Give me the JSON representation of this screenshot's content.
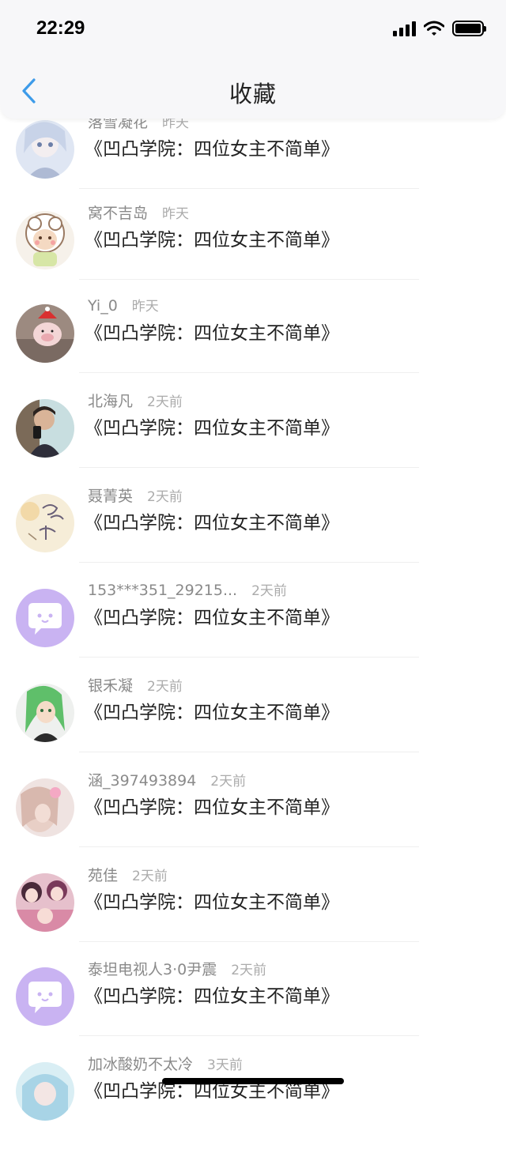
{
  "status_bar": {
    "time": "22:29"
  },
  "header": {
    "title": "收藏",
    "back_icon": "chevron-left-icon",
    "accent_color": "#3d9be9"
  },
  "favorites": [
    {
      "user": "落雪凝花",
      "time": "昨天",
      "title": "《凹凸学院：四位女主不简单》",
      "avatar": "anime-girl-avatar"
    },
    {
      "user": "窝不吉岛",
      "time": "昨天",
      "title": "《凹凸学院：四位女主不简单》",
      "avatar": "cartoon-sheep-avatar"
    },
    {
      "user": "Yi_0",
      "time": "昨天",
      "title": "《凹凸学院：四位女主不简单》",
      "avatar": "pig-photo-avatar"
    },
    {
      "user": "北海凡",
      "time": "2天前",
      "title": "《凹凸学院：四位女主不简单》",
      "avatar": "selfie-photo-avatar"
    },
    {
      "user": "聂菁英",
      "time": "2天前",
      "title": "《凹凸学院：四位女主不简单》",
      "avatar": "handwriting-avatar"
    },
    {
      "user": "153***351_29215...",
      "time": "2天前",
      "title": "《凹凸学院：四位女主不简单》",
      "avatar": "default-chat-bubble-avatar"
    },
    {
      "user": "银禾凝",
      "time": "2天前",
      "title": "《凹凸学院：四位女主不简单》",
      "avatar": "green-hair-anime-avatar"
    },
    {
      "user": "涵_397493894",
      "time": "2天前",
      "title": "《凹凸学院：四位女主不简单》",
      "avatar": "pink-photo-avatar"
    },
    {
      "user": "苑佳",
      "time": "2天前",
      "title": "《凹凸学院：四位女主不简单》",
      "avatar": "anime-group-avatar"
    },
    {
      "user": "泰坦电视人3·0尹震",
      "time": "2天前",
      "title": "《凹凸学院：四位女主不简单》",
      "avatar": "default-chat-bubble-avatar"
    },
    {
      "user": "加冰酸奶不太冷",
      "time": "3天前",
      "title": "《凹凸学院：四位女主不简单》",
      "avatar": "blue-anime-avatar"
    }
  ],
  "colors": {
    "default_avatar_bg": "#c9b3f2",
    "username": "#8a8a8a",
    "timestamp": "#ababab",
    "title_text": "#222222"
  }
}
